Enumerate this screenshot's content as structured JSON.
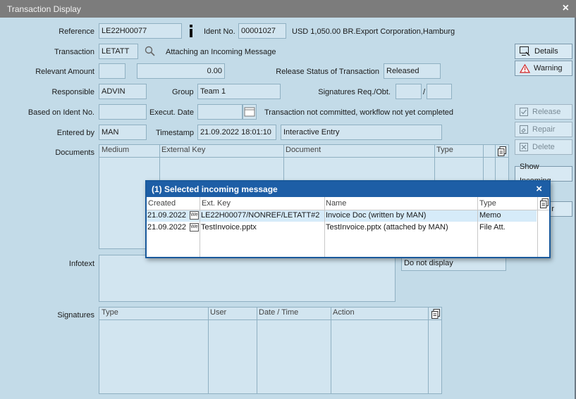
{
  "window": {
    "title": "Transaction Display",
    "close_icon": "×"
  },
  "labels": {
    "reference": "Reference",
    "ident_no": "Ident No.",
    "transaction": "Transaction",
    "relevant_amount": "Relevant Amount",
    "release_status": "Release Status of Transaction",
    "responsible": "Responsible",
    "group": "Group",
    "signatures_req": "Signatures Req./Obt.",
    "based_on_ident": "Based on Ident No.",
    "execut_date": "Execut. Date",
    "entered_by": "Entered by",
    "timestamp": "Timestamp",
    "documents": "Documents",
    "infotext": "Infotext",
    "signatures": "Signatures",
    "slash": "/"
  },
  "fields": {
    "reference": "LE22H00077",
    "ident_no": "00001027",
    "ident_summary": "USD 1,050.00 BR.Export Corporation,Hamburg",
    "transaction": "LETATT",
    "transaction_desc": "Attaching an Incoming Message",
    "relevant_amount_ccy": "",
    "relevant_amount": "0.00",
    "release_status": "Released",
    "responsible": "ADVIN",
    "group": "Team 1",
    "sig_req": "",
    "sig_obt": "",
    "based_on_ident": "",
    "execut_date": "",
    "workflow_note": "Transaction not committed, workflow not yet completed",
    "entered_by": "MAN",
    "timestamp": "21.09.2022 18:01:10",
    "entry_type": "Interactive Entry",
    "infotext_display": "Do not display"
  },
  "buttons": {
    "details": "Details",
    "warning": "Warning",
    "release": "Release",
    "repair": "Repair",
    "delete": "Delete",
    "show_incoming": "Show Incoming",
    "hidden_partial": "r"
  },
  "documents_grid": {
    "columns": [
      "Medium",
      "External Key",
      "Document",
      "Type"
    ]
  },
  "signatures_grid": {
    "columns": [
      "Type",
      "User",
      "Date / Time",
      "Action"
    ]
  },
  "dialog": {
    "title": "(1) Selected incoming message",
    "close_icon": "×",
    "columns": [
      "Created",
      "Ext. Key",
      "Name",
      "Type"
    ],
    "rows": [
      {
        "created": "21.09.2022",
        "icon_text": "We",
        "ext_key": "LE22H00077/NONREF/LETATT#2",
        "name": "Invoice Doc (written by MAN)",
        "type": "Memo"
      },
      {
        "created": "21.09.2022",
        "icon_text": "We",
        "ext_key": "TestInvoice.pptx",
        "name": "TestInvoice.pptx (attached by MAN)",
        "type": "File Att."
      }
    ]
  },
  "colors": {
    "window_bg": "#c3dbe8",
    "field_bg": "#d2e5f0",
    "dialog_title_bg": "#1d5ea6",
    "selected_row_bg": "#d6ebf9"
  }
}
